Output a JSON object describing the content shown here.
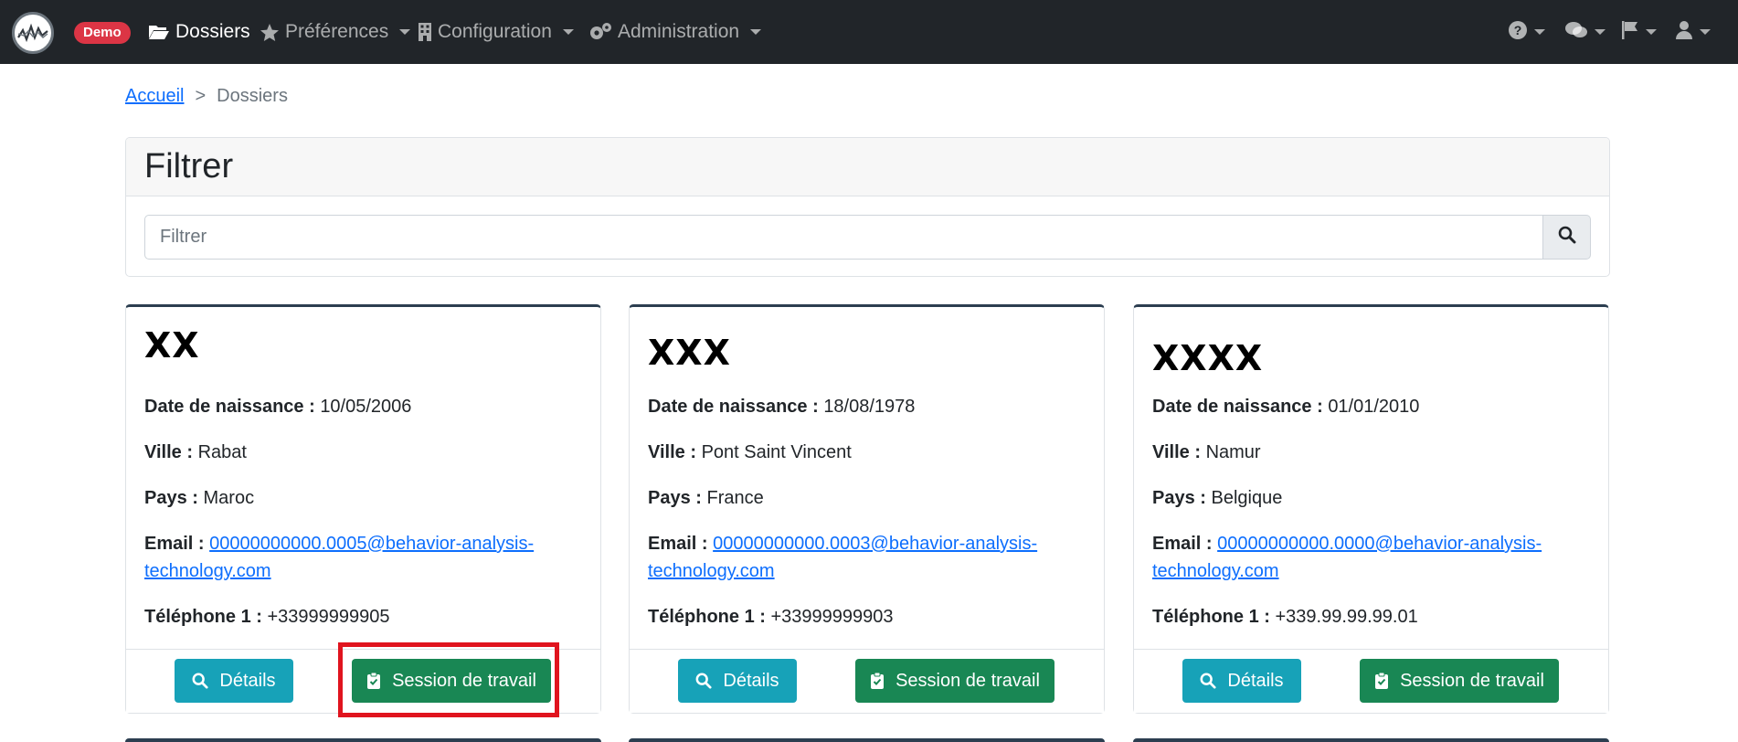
{
  "navbar": {
    "badge": "Demo",
    "items": [
      {
        "label": "Dossiers",
        "icon": "folder-open-icon"
      },
      {
        "label": "Préférences",
        "icon": "star-icon"
      },
      {
        "label": "Configuration",
        "icon": "building-icon"
      },
      {
        "label": "Administration",
        "icon": "cogs-icon"
      }
    ],
    "right_icons": [
      "help-icon",
      "comments-icon",
      "flag-icon",
      "user-icon"
    ]
  },
  "breadcrumb": {
    "home": "Accueil",
    "separator": ">",
    "current": "Dossiers"
  },
  "filter": {
    "title": "Filtrer",
    "placeholder": "Filtrer"
  },
  "cards": [
    {
      "name": "XX",
      "dob_label": "Date de naissance :",
      "dob": "10/05/2006",
      "city_label": "Ville :",
      "city": "Rabat",
      "country_label": "Pays :",
      "country": "Maroc",
      "email_label": "Email :",
      "email_line1": "00000000000.0005@behavior-analysis-",
      "email_line2": "technology.com",
      "phone_label": "Téléphone 1 :",
      "phone": "+33999999905",
      "details": "Détails",
      "session": "Session de travail"
    },
    {
      "name": "XXX",
      "dob_label": "Date de naissance :",
      "dob": "18/08/1978",
      "city_label": "Ville :",
      "city": "Pont Saint Vincent",
      "country_label": "Pays :",
      "country": "France",
      "email_label": "Email :",
      "email_line1": "00000000000.0003@behavior-analysis-",
      "email_line2": "technology.com",
      "phone_label": "Téléphone 1 :",
      "phone": "+33999999903",
      "details": "Détails",
      "session": "Session de travail"
    },
    {
      "name": "XXXX",
      "dob_label": "Date de naissance :",
      "dob": "01/01/2010",
      "city_label": "Ville :",
      "city": "Namur",
      "country_label": "Pays :",
      "country": "Belgique",
      "email_label": "Email :",
      "email_line1": "00000000000.0000@behavior-analysis-",
      "email_line2": "technology.com",
      "phone_label": "Téléphone 1 :",
      "phone": "+339.99.99.99.01",
      "details": "Détails",
      "session": "Session de travail"
    }
  ],
  "colors": {
    "navbar": "#212529",
    "badge": "#dc3545",
    "info": "#17a2b8",
    "success": "#198754",
    "link": "#0d6efd",
    "highlight": "#e0141e"
  }
}
